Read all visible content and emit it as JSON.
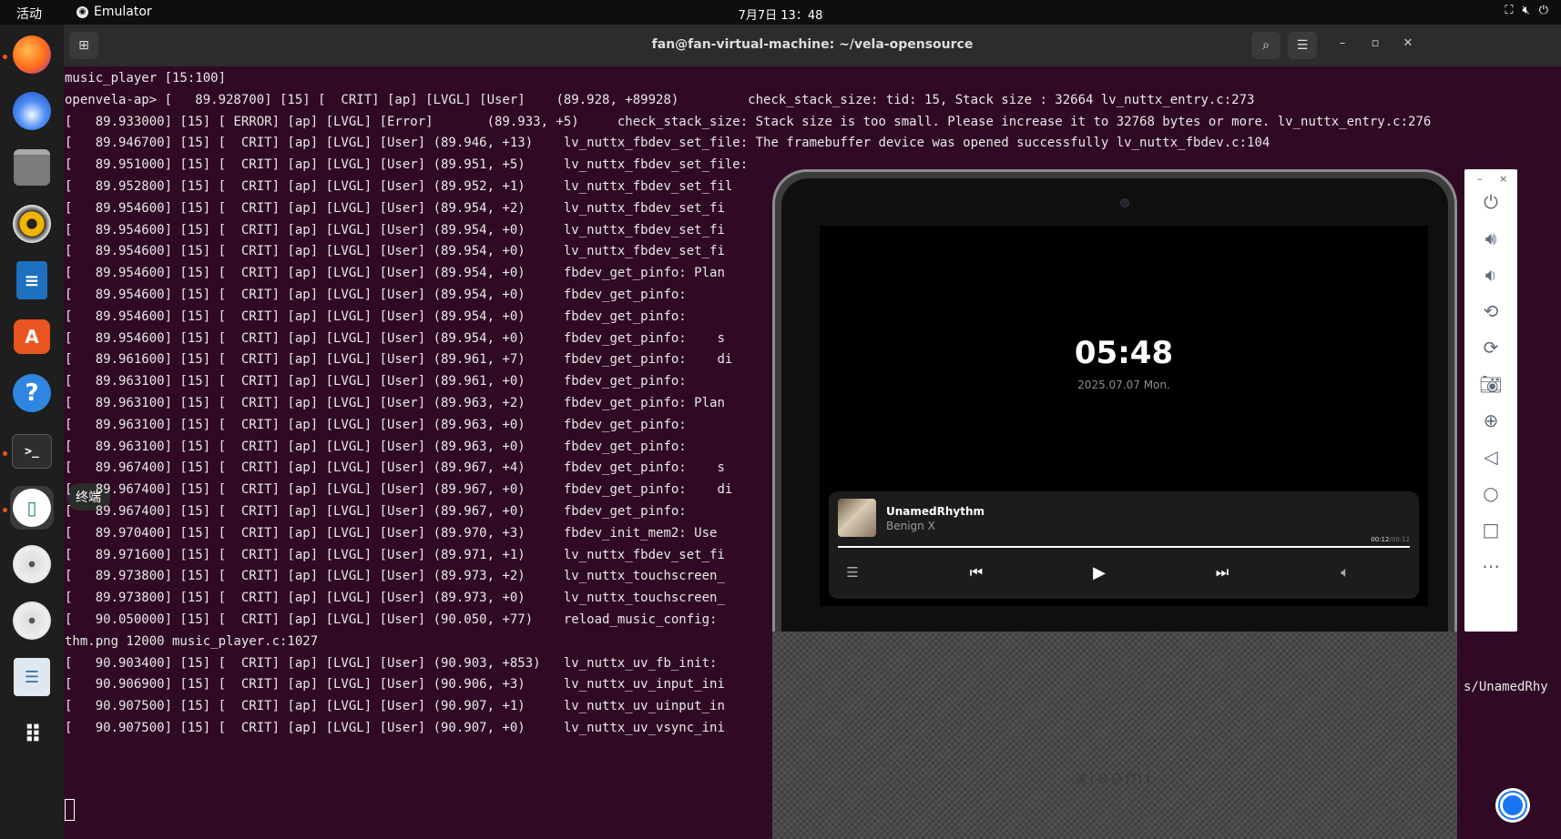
{
  "topbar": {
    "activities": "活动",
    "app_name": "Emulator",
    "clock": "7月7日 13：48"
  },
  "dock": {
    "tooltip": "终端",
    "items": [
      "firefox-icon",
      "thunderbird-icon",
      "files-icon",
      "rhythmbox-icon",
      "writer-icon",
      "app-center-icon",
      "help-icon",
      "terminal-icon",
      "emulator-icon",
      "disc-icon",
      "disc-icon",
      "text-editor-icon",
      "app-grid-icon"
    ]
  },
  "terminal": {
    "title": "fan@fan-virtual-machine: ~/vela-opensource",
    "lines": [
      "music_player [15:100]",
      "openvela-ap> [   89.928700] [15] [  CRIT] [ap] [LVGL] [User]    (89.928, +89928)         check_stack_size: tid: 15, Stack size : 32664 lv_nuttx_entry.c:273",
      "[   89.933000] [15] [ ERROR] [ap] [LVGL] [Error]       (89.933, +5)     check_stack_size: Stack size is too small. Please increase it to 32768 bytes or more. lv_nuttx_entry.c:276",
      "[   89.946700] [15] [  CRIT] [ap] [LVGL] [User] (89.946, +13)    lv_nuttx_fbdev_set_file: The framebuffer device was opened successfully lv_nuttx_fbdev.c:104",
      "[   89.951000] [15] [  CRIT] [ap] [LVGL] [User] (89.951, +5)     lv_nuttx_fbdev_set_file:",
      "[   89.952800] [15] [  CRIT] [ap] [LVGL] [User] (89.952, +1)     lv_nuttx_fbdev_set_fil",
      "[   89.954600] [15] [  CRIT] [ap] [LVGL] [User] (89.954, +2)     lv_nuttx_fbdev_set_fi",
      "[   89.954600] [15] [  CRIT] [ap] [LVGL] [User] (89.954, +0)     lv_nuttx_fbdev_set_fi",
      "[   89.954600] [15] [  CRIT] [ap] [LVGL] [User] (89.954, +0)     lv_nuttx_fbdev_set_fi",
      "[   89.954600] [15] [  CRIT] [ap] [LVGL] [User] (89.954, +0)     fbdev_get_pinfo: Plan",
      "[   89.954600] [15] [  CRIT] [ap] [LVGL] [User] (89.954, +0)     fbdev_get_pinfo:",
      "[   89.954600] [15] [  CRIT] [ap] [LVGL] [User] (89.954, +0)     fbdev_get_pinfo:",
      "[   89.954600] [15] [  CRIT] [ap] [LVGL] [User] (89.954, +0)     fbdev_get_pinfo:    s",
      "[   89.961600] [15] [  CRIT] [ap] [LVGL] [User] (89.961, +7)     fbdev_get_pinfo:    di",
      "[   89.963100] [15] [  CRIT] [ap] [LVGL] [User] (89.961, +0)     fbdev_get_pinfo:",
      "[   89.963100] [15] [  CRIT] [ap] [LVGL] [User] (89.963, +2)     fbdev_get_pinfo: Plan",
      "[   89.963100] [15] [  CRIT] [ap] [LVGL] [User] (89.963, +0)     fbdev_get_pinfo:",
      "[   89.963100] [15] [  CRIT] [ap] [LVGL] [User] (89.963, +0)     fbdev_get_pinfo:",
      "[   89.967400] [15] [  CRIT] [ap] [LVGL] [User] (89.967, +4)     fbdev_get_pinfo:    s",
      "[   89.967400] [15] [  CRIT] [ap] [LVGL] [User] (89.967, +0)     fbdev_get_pinfo:    di",
      "[   89.967400] [15] [  CRIT] [ap] [LVGL] [User] (89.967, +0)     fbdev_get_pinfo:",
      "[   89.970400] [15] [  CRIT] [ap] [LVGL] [User] (89.970, +3)     fbdev_init_mem2: Use",
      "[   89.971600] [15] [  CRIT] [ap] [LVGL] [User] (89.971, +1)     lv_nuttx_fbdev_set_fi",
      "[   89.973800] [15] [  CRIT] [ap] [LVGL] [User] (89.973, +2)     lv_nuttx_touchscreen_",
      "[   89.973800] [15] [  CRIT] [ap] [LVGL] [User] (89.973, +0)     lv_nuttx_touchscreen_",
      "[   90.050000] [15] [  CRIT] [ap] [LVGL] [User] (90.050, +77)    reload_music_config: ",
      "thm.png 12000 music_player.c:1027",
      "[   90.903400] [15] [  CRIT] [ap] [LVGL] [User] (90.903, +853)   lv_nuttx_uv_fb_init:",
      "[   90.906900] [15] [  CRIT] [ap] [LVGL] [User] (90.906, +3)     lv_nuttx_uv_input_ini",
      "[   90.907500] [15] [  CRIT] [ap] [LVGL] [User] (90.907, +1)     lv_nuttx_uv_uinput_in",
      "[   90.907500] [15] [  CRIT] [ap] [LVGL] [User] (90.907, +0)     lv_nuttx_uv_vsync_ini"
    ],
    "fragment_right": "s/UnamedRhy"
  },
  "device": {
    "time": "05:48",
    "date": "2025.07.07 Mon.",
    "song_title": "UnamedRhythm",
    "artist": "Benign X",
    "elapsed": "00:12",
    "duration": "/00:12",
    "progress": 1.0,
    "brand": "xiaomi"
  },
  "sidepanel": {
    "minimize": "–",
    "close": "×",
    "buttons": [
      "power-icon",
      "volume-up-icon",
      "volume-down-icon",
      "rotate-left-icon",
      "rotate-right-icon",
      "camera-icon",
      "zoom-icon",
      "back-icon",
      "home-icon",
      "overview-icon",
      "more-icon"
    ]
  }
}
